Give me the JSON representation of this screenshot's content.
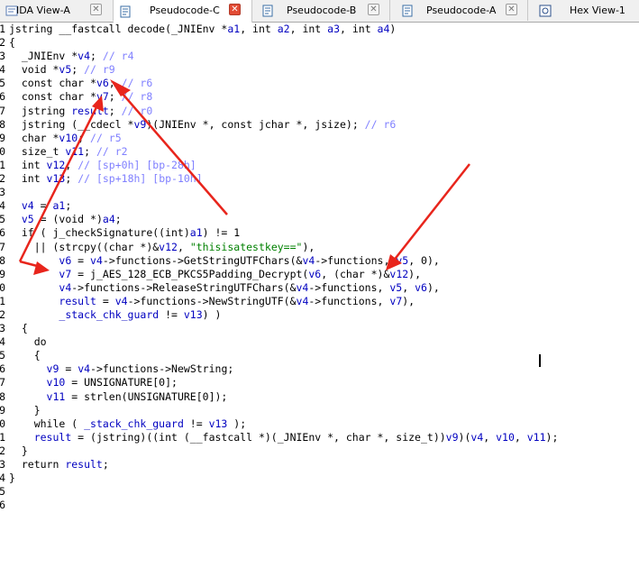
{
  "tabs": [
    {
      "label": "IDA View-A",
      "icon": "ida-view-icon"
    },
    {
      "label": "Pseudocode-C",
      "icon": "pseudocode-icon",
      "active": true
    },
    {
      "label": "Pseudocode-B",
      "icon": "pseudocode-icon"
    },
    {
      "label": "Pseudocode-A",
      "icon": "pseudocode-icon"
    },
    {
      "label": "Hex View-1",
      "icon": "hex-view-icon"
    }
  ],
  "gutter": [
    "1",
    "2",
    "3",
    "4",
    "5",
    "6",
    "7",
    "8",
    "9",
    "0",
    "1",
    "2",
    "3",
    "4",
    "5",
    "6",
    "7",
    "8",
    "9",
    "0",
    "1",
    "2",
    "3",
    "4",
    "5",
    "6",
    "7",
    "8",
    "9",
    "0",
    "1",
    "2",
    "3",
    "4",
    "5",
    "6"
  ],
  "code_lines": [
    "jstring __fastcall decode(_JNIEnv *a1, int a2, int a3, int a4)",
    "{",
    "  _JNIEnv *v4; // r4",
    "  void *v5; // r9",
    "  const char *v6; // r6",
    "  const char *v7; // r8",
    "  jstring result; // r0",
    "  jstring (__cdecl *v9)(JNIEnv *, const jchar *, jsize); // r6",
    "  char *v10; // r5",
    "  size_t v11; // r2",
    "  int v12; // [sp+0h] [bp-28h]",
    "  int v13; // [sp+18h] [bp-10h]",
    "",
    "  v4 = a1;",
    "  v5 = (void *)a4;",
    "  if ( j_checkSignature((int)a1) != 1",
    "    || (strcpy((char *)&v12, \"thisisatestkey==\"),",
    "        v6 = v4->functions->GetStringUTFChars(&v4->functions, v5, 0),",
    "        v7 = j_AES_128_ECB_PKCS5Padding_Decrypt(v6, (char *)&v12),",
    "        v4->functions->ReleaseStringUTFChars(&v4->functions, v5, v6),",
    "        result = v4->functions->NewStringUTF(&v4->functions, v7),",
    "        _stack_chk_guard != v13) )",
    "  {",
    "    do",
    "    {",
    "      v9 = v4->functions->NewString;",
    "      v10 = UNSIGNATURE[0];",
    "      v11 = strlen(UNSIGNATURE[0]);",
    "    }",
    "    while ( _stack_chk_guard != v13 );",
    "    result = (jstring)((int (__fastcall *)(_JNIEnv *, char *, size_t))v9)(v4, v10, v11);",
    "  }",
    "  return result;",
    "}"
  ],
  "colors": {
    "comment": "#8080ff",
    "variable": "#0000c0",
    "string": "#008000",
    "annotation_arrow": "#e8251c",
    "active_tab_close": "#e24b34"
  }
}
